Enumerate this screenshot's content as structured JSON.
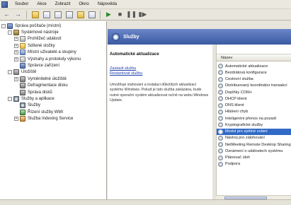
{
  "menu": [
    "Soubor",
    "Akce",
    "Zobrazit",
    "Okno",
    "Nápověda"
  ],
  "toolbar": {
    "buttons": [
      "back",
      "forward",
      "up",
      "show-hide-tree",
      "properties",
      "refresh",
      "export",
      "help",
      "start",
      "stop",
      "pause",
      "restart"
    ]
  },
  "tree": [
    {
      "label": "Správa počítače (místní)",
      "icon": "computer-icon",
      "level": 0,
      "expander": "-"
    },
    {
      "label": "Systémové nástroje",
      "icon": "tools-icon",
      "level": 1,
      "expander": "-"
    },
    {
      "label": "Prohlížeč událostí",
      "icon": "log-icon",
      "level": 2,
      "expander": "+"
    },
    {
      "label": "Sdílené složky",
      "icon": "folder-icon",
      "level": 2,
      "expander": "+"
    },
    {
      "label": "Místní uživatelé a skupiny",
      "icon": "users-icon",
      "level": 2,
      "expander": "+"
    },
    {
      "label": "Výstrahy a protokoly výkonu",
      "icon": "log-icon",
      "level": 2,
      "expander": "+"
    },
    {
      "label": "Správce zařízení",
      "icon": "computer-icon",
      "level": 2,
      "expander": ""
    },
    {
      "label": "Úložiště",
      "icon": "disk-icon",
      "level": 1,
      "expander": "-"
    },
    {
      "label": "Vyměnitelné úložiště",
      "icon": "disk-icon",
      "level": 2,
      "expander": "+"
    },
    {
      "label": "Defragmentace disku",
      "icon": "disk-icon",
      "level": 2,
      "expander": ""
    },
    {
      "label": "Správa disků",
      "icon": "disk-icon",
      "level": 2,
      "expander": ""
    },
    {
      "label": "Služby a aplikace",
      "icon": "gear-icon",
      "level": 1,
      "expander": "-"
    },
    {
      "label": "Služby",
      "icon": "gear-icon",
      "level": 2,
      "expander": ""
    },
    {
      "label": "Řízení služby WMI",
      "icon": "wmi-icon",
      "level": 2,
      "expander": ""
    },
    {
      "label": "Služba Indexing Service",
      "icon": "index-icon",
      "level": 2,
      "expander": "+"
    }
  ],
  "header": {
    "title": "Služby"
  },
  "description": {
    "title": "Automatické aktualizace",
    "links": [
      "Zastavit službu",
      "Restartovat službu"
    ],
    "text": "Umožňuje stahování a instalaci důležitých aktualizací systému Windows. Pokud je tato služba zakázána, bude nutné operační systém aktualizovat ručně na webu Windows Update."
  },
  "services": {
    "column_header": "Název",
    "selected_index": 10,
    "items": [
      "Automatické aktualizace",
      "Bezdrátová konfigurace",
      "Cestovní služba",
      "Distribuovaný koordinátor transakcí",
      "Doplňky COM+",
      "DHCP klient",
      "DNS klient",
      "Hlášení chyb",
      "Inteligentní přenos na pozadí",
      "Kryptografické služby",
      "Modul pro zpětné volání",
      "Nástroj pro zálohování",
      "NetMeeting Remote Desktop Sharing",
      "Oznámení o událostech systému",
      "Plánovač úloh",
      "Podpora"
    ]
  }
}
